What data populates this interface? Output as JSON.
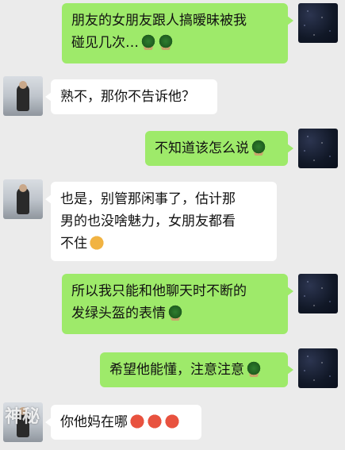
{
  "messages": [
    {
      "side": "right",
      "lines": [
        "朋友的女朋友跟人搞暧昧被我",
        "碰见几次…"
      ],
      "trail": [
        "turtle-icon",
        "turtle-icon"
      ]
    },
    {
      "side": "left",
      "lines": [
        "熟不，那你不告诉他？"
      ],
      "trail": []
    },
    {
      "side": "right",
      "lines": [
        "不知道该怎么说"
      ],
      "trail": [
        "turtle-icon"
      ]
    },
    {
      "side": "left",
      "lines": [
        "也是，别管那闲事了，估计那",
        "男的也没啥魅力，女朋友都看",
        "不住"
      ],
      "trail": [
        "grinning-face-icon"
      ]
    },
    {
      "side": "right",
      "lines": [
        "所以我只能和他聊天时不断的",
        "发绿头盔的表情"
      ],
      "trail": [
        "turtle-icon"
      ]
    },
    {
      "side": "right",
      "lines": [
        "希望他能懂，注意注意"
      ],
      "trail": [
        "turtle-icon"
      ]
    },
    {
      "side": "left",
      "lines": [
        "你他妈在哪"
      ],
      "trail": [
        "angry-face-icon",
        "angry-face-icon",
        "angry-face-icon"
      ]
    }
  ],
  "watermark": "神秘"
}
